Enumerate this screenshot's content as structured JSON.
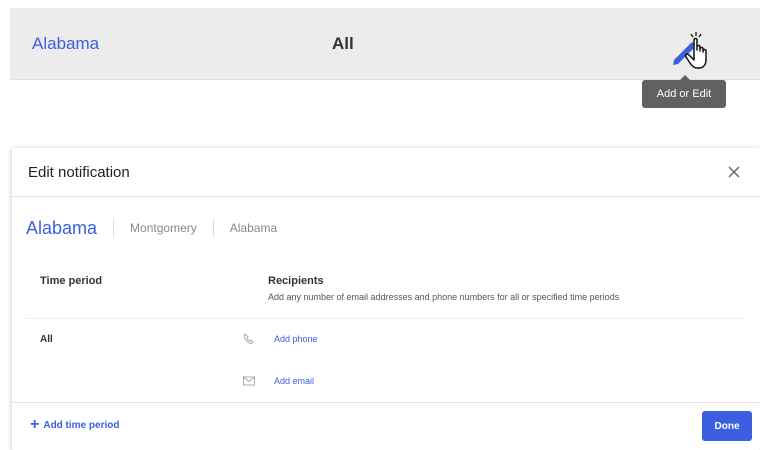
{
  "row": {
    "state_link": "Alabama",
    "period": "All",
    "tooltip": "Add or Edit"
  },
  "dialog": {
    "title": "Edit notification",
    "breadcrumb": {
      "main": "Alabama",
      "city": "Montgomery",
      "state": "Alabama"
    },
    "columns": {
      "time_period": "Time period",
      "recipients": "Recipients",
      "recipients_desc": "Add any number of email addresses and phone numbers for all or specified time periods"
    },
    "period_value": "All",
    "add_phone": "Add phone",
    "add_email": "Add email",
    "add_time_period": "Add time period",
    "done_label": "Done"
  },
  "icons": {
    "edit": "pencil-icon",
    "cursor": "hand-pointer-icon",
    "close": "close-icon",
    "phone": "phone-icon",
    "email": "email-icon",
    "plus": "plus-icon"
  },
  "colors": {
    "accent": "#3b5fe0",
    "tooltip_bg": "#616161"
  }
}
